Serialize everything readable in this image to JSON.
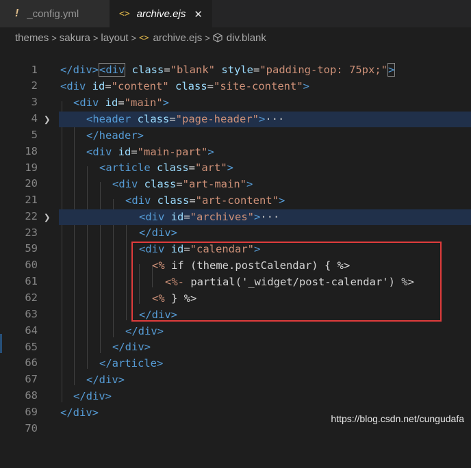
{
  "tabs": [
    {
      "icon": "!",
      "label": "_config.yml",
      "active": false
    },
    {
      "icon": "<>",
      "label": "archive.ejs",
      "active": true,
      "close": "✕"
    }
  ],
  "breadcrumb": [
    "themes",
    "sakura",
    "layout",
    "archive.ejs",
    "div.blank"
  ],
  "lines": [
    {
      "n": "1"
    },
    {
      "n": "2"
    },
    {
      "n": "3"
    },
    {
      "n": "4"
    },
    {
      "n": "5"
    },
    {
      "n": "18"
    },
    {
      "n": "19"
    },
    {
      "n": "20"
    },
    {
      "n": "21"
    },
    {
      "n": "22"
    },
    {
      "n": "23"
    },
    {
      "n": "59"
    },
    {
      "n": "60"
    },
    {
      "n": "61"
    },
    {
      "n": "62"
    },
    {
      "n": "63"
    },
    {
      "n": "64"
    },
    {
      "n": "65"
    },
    {
      "n": "66"
    },
    {
      "n": "67"
    },
    {
      "n": "68"
    },
    {
      "n": "69"
    },
    {
      "n": "70"
    }
  ],
  "code": {
    "l1": {
      "t1": "<div",
      "a1": " class",
      "eq1": "=",
      "s1": "\"blank\"",
      "a2": " style",
      "eq2": "=",
      "s2": "\"padding-top: 75px;\"",
      "t2": ">"
    },
    "l2": "</div>",
    "l3": {
      "t1": "<div",
      "a1": " id",
      "eq1": "=",
      "s1": "\"content\"",
      "a2": " class",
      "eq2": "=",
      "s2": "\"site-content\"",
      "t2": ">"
    },
    "l4": {
      "t1": "<div",
      "a1": " id",
      "eq1": "=",
      "s1": "\"main\"",
      "t2": ">"
    },
    "l5": {
      "t1": "<header",
      "a1": " class",
      "eq1": "=",
      "s1": "\"page-header\"",
      "t2": ">",
      "ell": "···"
    },
    "l18": "</header>",
    "l19": {
      "t1": "<div",
      "a1": " id",
      "eq1": "=",
      "s1": "\"main-part\"",
      "t2": ">"
    },
    "l20": {
      "t1": "<article",
      "a1": " class",
      "eq1": "=",
      "s1": "\"art\"",
      "t2": ">"
    },
    "l21": {
      "t1": "<div",
      "a1": " class",
      "eq1": "=",
      "s1": "\"art-main\"",
      "t2": ">"
    },
    "l22": {
      "t1": "<div",
      "a1": " class",
      "eq1": "=",
      "s1": "\"art-content\"",
      "t2": ">"
    },
    "l23": {
      "t1": "<div",
      "a1": " id",
      "eq1": "=",
      "s1": "\"archives\"",
      "t2": ">",
      "ell": "···"
    },
    "l59": "</div>",
    "l60": {
      "t1": "<div",
      "a1": " id",
      "eq1": "=",
      "s1": "\"calendar\"",
      "t2": ">"
    },
    "l61": {
      "open": "<%",
      "body": " if (theme.postCalendar) { ",
      "close": "%>"
    },
    "l62": {
      "open": "<%-",
      "body": " partial('_widget/post-calendar') ",
      "close": "%>"
    },
    "l63": {
      "open": "<%",
      "body": " } ",
      "close": "%>"
    },
    "l64": "</div>",
    "l65": "</div>",
    "l66": "</div>",
    "l67": "</article>",
    "l68": "</div>",
    "l69": "</div>",
    "l70": "</div>"
  },
  "watermark": "https://blog.csdn.net/cungudafa"
}
